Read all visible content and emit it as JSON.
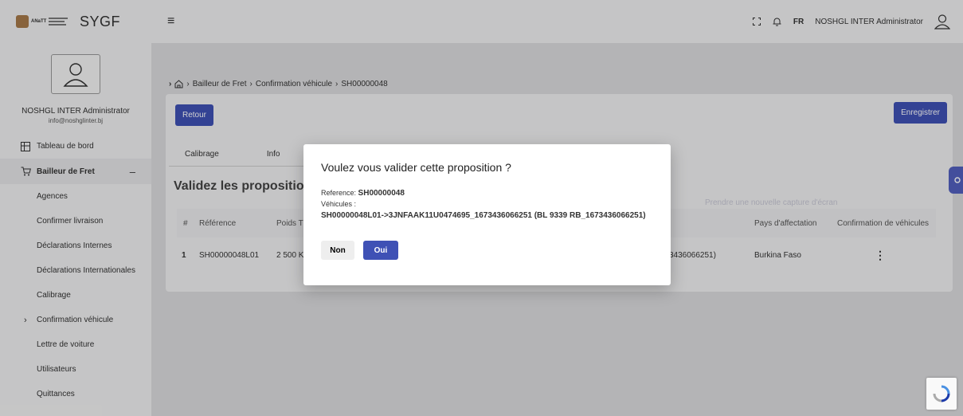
{
  "app": {
    "brand_text": "ANaTT",
    "name": "SYGF"
  },
  "user": {
    "name": "NOSHGL INTER Administrator",
    "email": "info@noshglinter.bj"
  },
  "topbar": {
    "lang": "FR",
    "user_name": "NOSHGL INTER Administrator"
  },
  "sidebar": {
    "items": [
      {
        "label": "Tableau de bord",
        "icon": "dashboard-icon"
      },
      {
        "label": "Bailleur de Fret",
        "icon": "cart-icon"
      },
      {
        "label": "Agences"
      },
      {
        "label": "Confirmer livraison"
      },
      {
        "label": "Déclarations Internes"
      },
      {
        "label": "Déclarations Internationales"
      },
      {
        "label": "Calibrage"
      },
      {
        "label": "Confirmation véhicule"
      },
      {
        "label": "Lettre de voiture"
      },
      {
        "label": "Utilisateurs"
      },
      {
        "label": "Quittances"
      }
    ]
  },
  "breadcrumb": {
    "items": [
      "Bailleur de Fret",
      "Confirmation véhicule",
      "SH00000048"
    ]
  },
  "buttons": {
    "back": "Retour",
    "save": "Enregistrer",
    "new_capture": "Prendre une nouvelle capture d'écran"
  },
  "tabs": {
    "calibrage": "Calibrage",
    "info": "Info"
  },
  "section": {
    "title": "Validez les propositions"
  },
  "table": {
    "headers": [
      "#",
      "Référence",
      "Poids T",
      "Pays d'affectation",
      "Confirmation de véhicules"
    ],
    "row": {
      "num": "1",
      "ref": "SH00000048L01",
      "poids": "2 500 K",
      "vehicle_tail": "3436066251)",
      "pays": "Burkina Faso"
    }
  },
  "modal": {
    "title": "Voulez vous valider cette proposition ?",
    "ref_label": "Reference:",
    "ref_value": "SH00000048",
    "vehicles_label": "Véhicules :",
    "vehicles_value": "SH00000048L01->3JNFAAK11U0474695_1673436066251 (BL 9339 RB_1673436066251)",
    "btn_no": "Non",
    "btn_yes": "Oui"
  },
  "colors": {
    "primary": "#3f51b5",
    "sidebar_bg": "#f1f1f2"
  }
}
